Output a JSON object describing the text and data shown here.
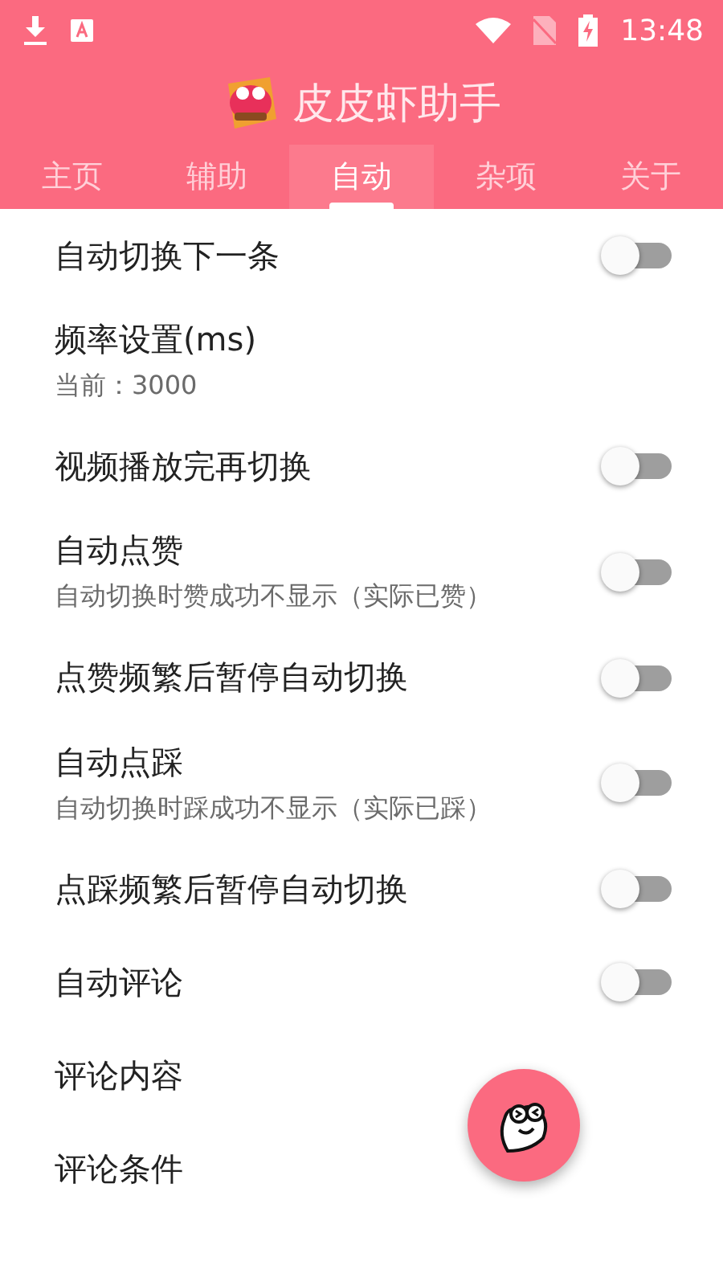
{
  "status_bar": {
    "time": "13:48"
  },
  "app_bar": {
    "title": "皮皮虾助手"
  },
  "tabs": [
    {
      "label": "主页",
      "selected": false
    },
    {
      "label": "辅助",
      "selected": false
    },
    {
      "label": "自动",
      "selected": true
    },
    {
      "label": "杂项",
      "selected": false
    },
    {
      "label": "关于",
      "selected": false
    }
  ],
  "settings": [
    {
      "kind": "switch",
      "title": "自动切换下一条",
      "on": false
    },
    {
      "kind": "plain",
      "title": "频率设置(ms)",
      "subtitle": "当前：3000"
    },
    {
      "kind": "switch",
      "title": "视频播放完再切换",
      "on": false
    },
    {
      "kind": "switch",
      "title": "自动点赞",
      "subtitle": "自动切换时赞成功不显示（实际已赞）",
      "on": false
    },
    {
      "kind": "switch",
      "title": "点赞频繁后暂停自动切换",
      "on": false
    },
    {
      "kind": "switch",
      "title": "自动点踩",
      "subtitle": "自动切换时踩成功不显示（实际已踩）",
      "on": false
    },
    {
      "kind": "switch",
      "title": "点踩频繁后暂停自动切换",
      "on": false
    },
    {
      "kind": "switch",
      "title": "自动评论",
      "on": false
    },
    {
      "kind": "plain",
      "title": "评论内容"
    },
    {
      "kind": "plain",
      "title": "评论条件"
    }
  ]
}
